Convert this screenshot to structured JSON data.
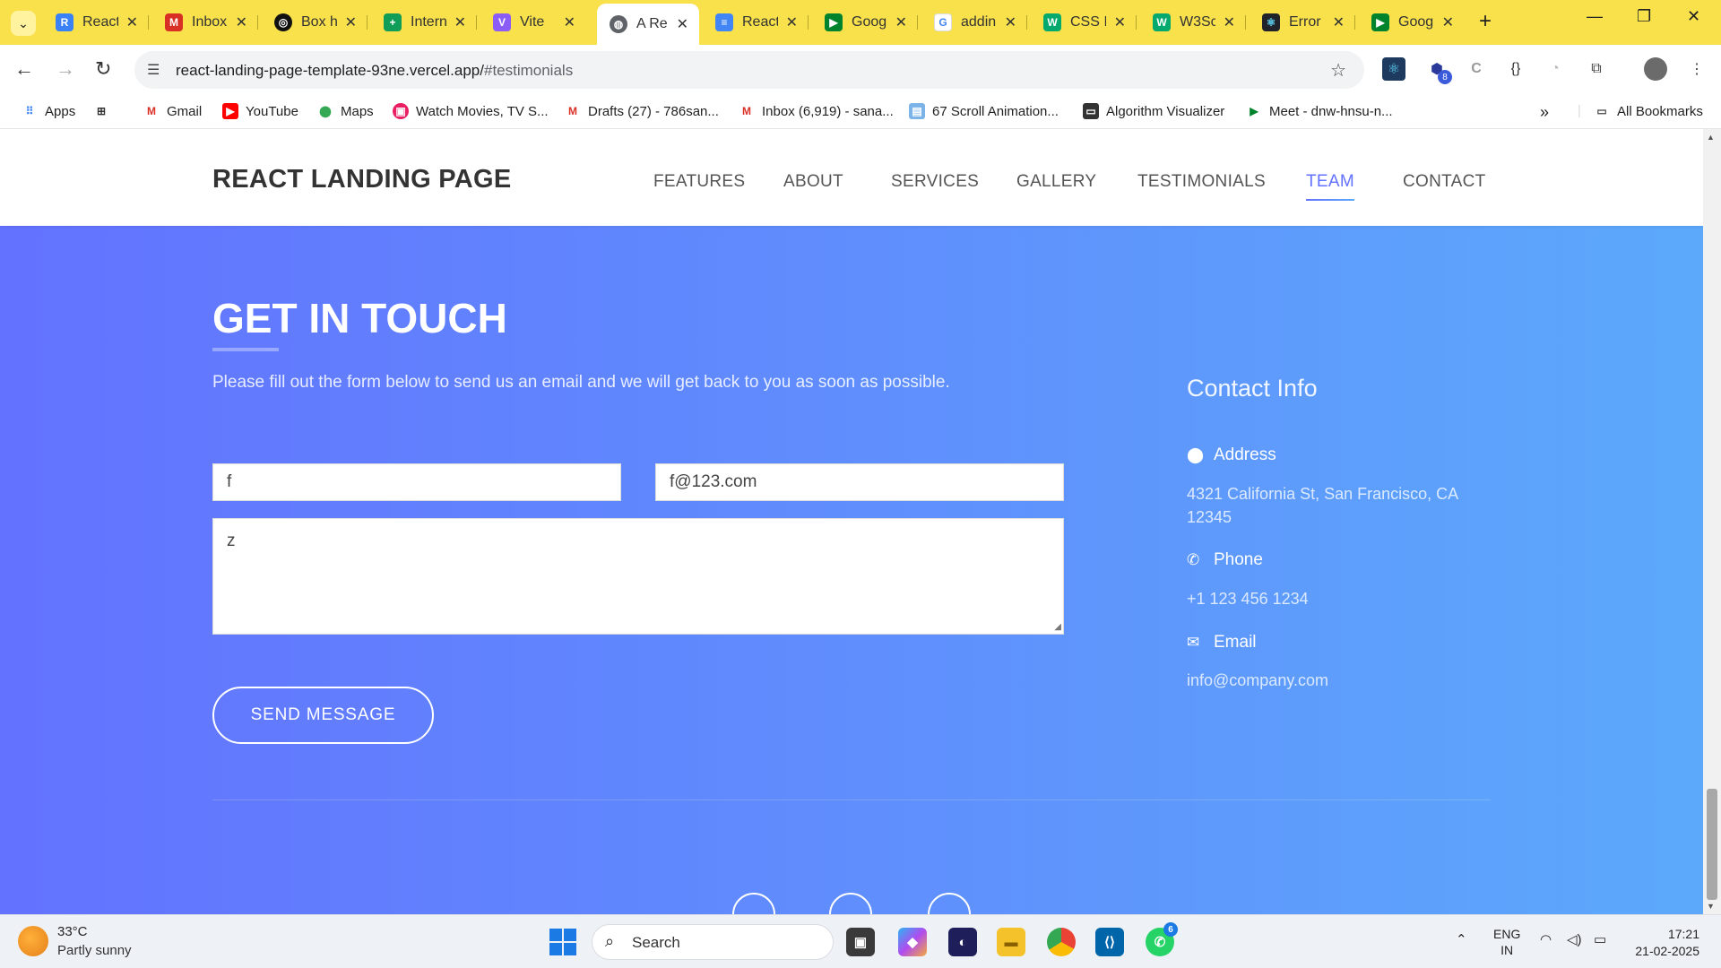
{
  "browser": {
    "tabs": [
      {
        "label": "React",
        "icon": "vite-react-icon",
        "color": "#3b82f6"
      },
      {
        "label": "Inbox",
        "icon": "gmail-icon",
        "color": "#d93025"
      },
      {
        "label": "Box h",
        "icon": "codepen-icon",
        "color": "#111111"
      },
      {
        "label": "Intern",
        "icon": "sheets-icon",
        "color": "#0f9d58"
      },
      {
        "label": "Vite",
        "icon": "vite-icon",
        "color": "#8b5cf6"
      },
      {
        "label": "A Re",
        "icon": "globe-icon",
        "color": "#5f6368"
      },
      {
        "label": "React",
        "icon": "docs-icon",
        "color": "#4285f4"
      },
      {
        "label": "Goog",
        "icon": "meet-icon",
        "color": "#00832d"
      },
      {
        "label": "addin",
        "icon": "google-icon",
        "color": "#4285f4"
      },
      {
        "label": "CSS I",
        "icon": "w3schools-icon",
        "color": "#04aa6d"
      },
      {
        "label": "W3Sc",
        "icon": "w3schools-icon",
        "color": "#04aa6d"
      },
      {
        "label": "Error",
        "icon": "react-icon",
        "color": "#20232a"
      },
      {
        "label": "Goog",
        "icon": "meet-icon",
        "color": "#00832d"
      }
    ],
    "url_host": "react-landing-page-template-93ne.vercel.app/",
    "url_path": "#testimonials",
    "bookmarks": [
      {
        "label": "Apps"
      },
      {
        "label": ""
      },
      {
        "label": "Gmail"
      },
      {
        "label": "YouTube"
      },
      {
        "label": "Maps"
      },
      {
        "label": "Watch Movies, TV S..."
      },
      {
        "label": "Drafts (27) - 786san..."
      },
      {
        "label": "Inbox (6,919) - sana..."
      },
      {
        "label": "67 Scroll Animation..."
      },
      {
        "label": "Algorithm Visualizer"
      },
      {
        "label": "Meet - dnw-hnsu-n..."
      }
    ],
    "all_bookmarks": "All Bookmarks",
    "extension_badge": "8"
  },
  "site": {
    "brand": "REACT LANDING PAGE",
    "nav": [
      "FEATURES",
      "ABOUT",
      "SERVICES",
      "GALLERY",
      "TESTIMONIALS",
      "TEAM",
      "CONTACT"
    ],
    "active_nav": "TEAM",
    "contact": {
      "title": "GET IN TOUCH",
      "subtitle": "Please fill out the form below to send us an email and we will get back to you as soon as possible.",
      "name_value": "f",
      "email_value": "f@123.com",
      "message_value": "z",
      "send_label": "SEND MESSAGE"
    },
    "contact_info": {
      "title": "Contact Info",
      "address_label": "Address",
      "address_value": "4321 California St, San Francisco, CA 12345",
      "phone_label": "Phone",
      "phone_value": "+1 123 456 1234",
      "email_label": "Email",
      "email_value": "info@company.com"
    },
    "colors": {
      "gradient_start": "#6372ff",
      "gradient_end": "#5ca9fb"
    }
  },
  "taskbar": {
    "temp": "33°C",
    "weather": "Partly sunny",
    "search_label": "Search",
    "lang_line1": "ENG",
    "lang_line2": "IN",
    "time": "17:21",
    "date": "21-02-2025",
    "whatsapp_badge": "6"
  }
}
